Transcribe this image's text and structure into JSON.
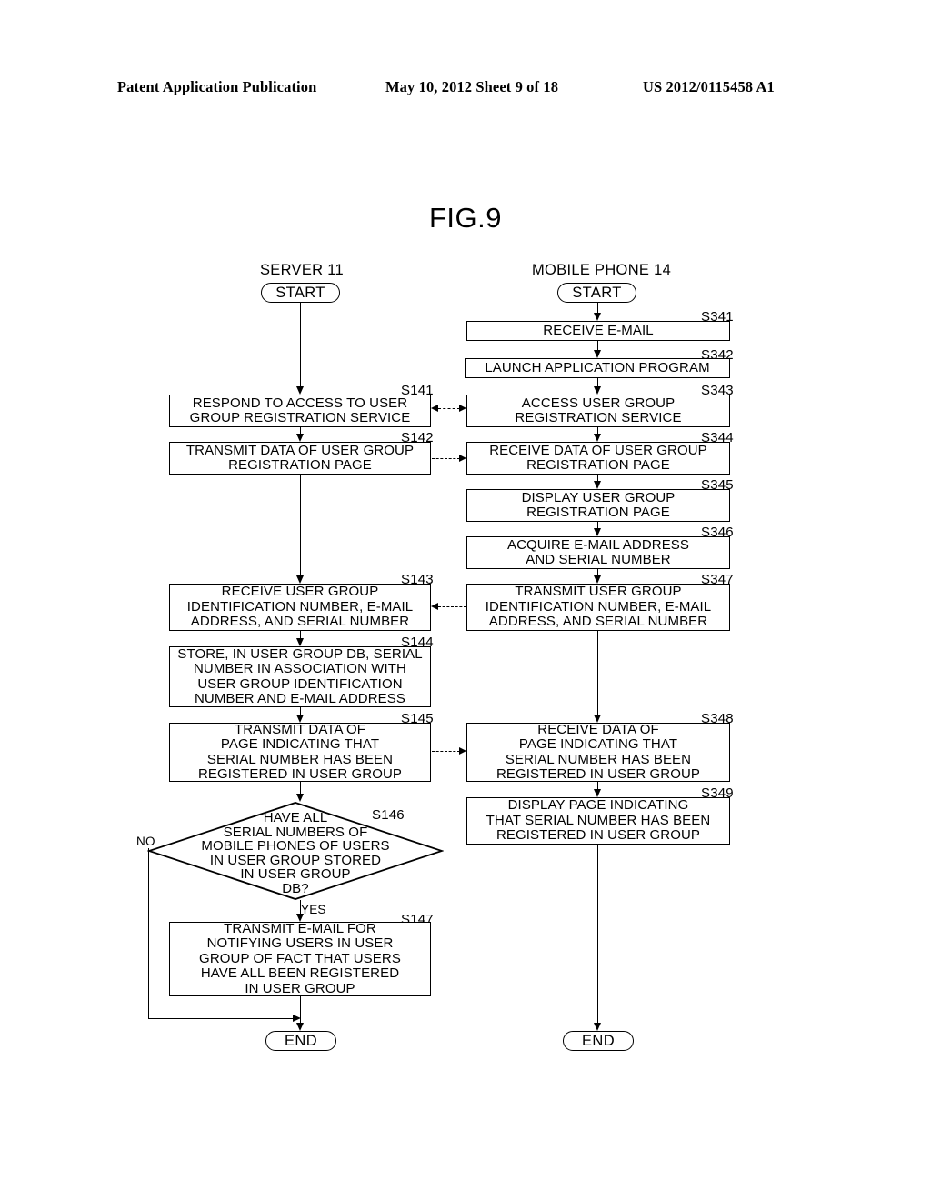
{
  "header": {
    "publication": "Patent Application Publication",
    "date_sheet": "May 10, 2012  Sheet 9 of 18",
    "patent_number": "US 2012/0115458 A1"
  },
  "figure": {
    "title": "FIG.9"
  },
  "columns": [
    {
      "label": "SERVER 11",
      "start": "START",
      "end": "END"
    },
    {
      "label": "MOBILE PHONE 14",
      "start": "START",
      "end": "END"
    }
  ],
  "branch_labels": {
    "no": "NO",
    "yes": "YES"
  },
  "chart_data": {
    "type": "diagram",
    "diagram_kind": "flowchart",
    "title": "FIG.9",
    "lanes": [
      "SERVER 11",
      "MOBILE PHONE 14"
    ]
  },
  "server_steps": [
    {
      "id": "S141",
      "shape": "process",
      "lines": [
        "RESPOND TO ACCESS TO USER",
        "GROUP REGISTRATION SERVICE"
      ]
    },
    {
      "id": "S142",
      "shape": "process",
      "lines": [
        "TRANSMIT DATA OF USER GROUP",
        "REGISTRATION PAGE"
      ]
    },
    {
      "id": "S143",
      "shape": "process",
      "lines": [
        "RECEIVE USER GROUP",
        "IDENTIFICATION NUMBER, E-MAIL",
        "ADDRESS, AND SERIAL NUMBER"
      ]
    },
    {
      "id": "S144",
      "shape": "process",
      "lines": [
        "STORE, IN USER GROUP DB, SERIAL",
        "NUMBER IN ASSOCIATION WITH",
        "USER GROUP IDENTIFICATION",
        "NUMBER AND E-MAIL ADDRESS"
      ]
    },
    {
      "id": "S145",
      "shape": "process",
      "lines": [
        "TRANSMIT DATA OF",
        "PAGE INDICATING THAT",
        "SERIAL NUMBER HAS BEEN",
        "REGISTERED IN USER GROUP"
      ]
    },
    {
      "id": "S146",
      "shape": "decision",
      "lines": [
        "HAVE ALL",
        "SERIAL NUMBERS OF",
        "MOBILE PHONES OF USERS",
        "IN USER GROUP STORED",
        "IN USER GROUP",
        "DB?"
      ]
    },
    {
      "id": "S147",
      "shape": "process",
      "lines": [
        "TRANSMIT E-MAIL FOR",
        "NOTIFYING USERS IN USER",
        "GROUP OF FACT THAT USERS",
        "HAVE ALL BEEN REGISTERED",
        "IN USER GROUP"
      ]
    }
  ],
  "phone_steps": [
    {
      "id": "S341",
      "shape": "process",
      "lines": [
        "RECEIVE E-MAIL"
      ]
    },
    {
      "id": "S342",
      "shape": "process",
      "lines": [
        "LAUNCH APPLICATION PROGRAM"
      ]
    },
    {
      "id": "S343",
      "shape": "process",
      "lines": [
        "ACCESS USER GROUP",
        "REGISTRATION SERVICE"
      ]
    },
    {
      "id": "S344",
      "shape": "process",
      "lines": [
        "RECEIVE DATA OF USER GROUP",
        "REGISTRATION PAGE"
      ]
    },
    {
      "id": "S345",
      "shape": "process",
      "lines": [
        "DISPLAY USER GROUP",
        "REGISTRATION PAGE"
      ]
    },
    {
      "id": "S346",
      "shape": "process",
      "lines": [
        "ACQUIRE E-MAIL ADDRESS",
        "AND SERIAL NUMBER"
      ]
    },
    {
      "id": "S347",
      "shape": "process",
      "lines": [
        "TRANSMIT USER GROUP",
        "IDENTIFICATION NUMBER, E-MAIL",
        "ADDRESS, AND SERIAL NUMBER"
      ]
    },
    {
      "id": "S348",
      "shape": "process",
      "lines": [
        "RECEIVE DATA OF",
        "PAGE INDICATING THAT",
        "SERIAL NUMBER HAS BEEN",
        "REGISTERED IN USER GROUP"
      ]
    },
    {
      "id": "S349",
      "shape": "process",
      "lines": [
        "DISPLAY PAGE INDICATING",
        "THAT SERIAL NUMBER HAS BEEN",
        "REGISTERED IN USER GROUP"
      ]
    }
  ]
}
